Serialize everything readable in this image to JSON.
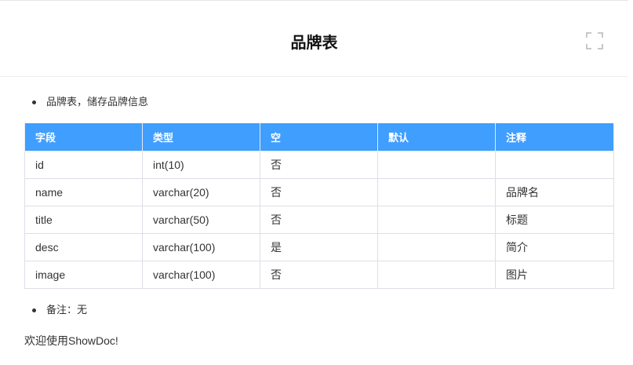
{
  "header": {
    "title": "品牌表",
    "fullscreen_icon": "fullscreen-icon"
  },
  "content": {
    "intro": "品牌表，储存品牌信息",
    "table": {
      "columns": [
        "字段",
        "类型",
        "空",
        "默认",
        "注释"
      ],
      "rows": [
        [
          "id",
          "int(10)",
          "否",
          "",
          ""
        ],
        [
          "name",
          "varchar(20)",
          "否",
          "",
          "品牌名"
        ],
        [
          "title",
          "varchar(50)",
          "否",
          "",
          "标题"
        ],
        [
          "desc",
          "varchar(100)",
          "是",
          "",
          "简介"
        ],
        [
          "image",
          "varchar(100)",
          "否",
          "",
          "图片"
        ]
      ]
    },
    "note": "备注：无",
    "footer": "欢迎使用ShowDoc!"
  },
  "colors": {
    "header_bg": "#409eff",
    "header_text": "#ffffff",
    "border": "#dcdfe6",
    "text": "#333333"
  }
}
